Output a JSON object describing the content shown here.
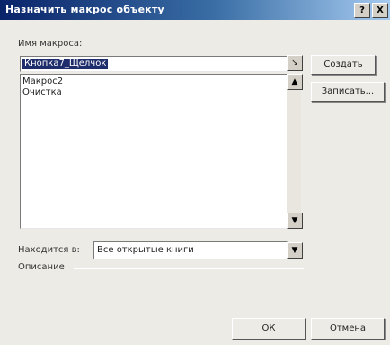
{
  "dialog": {
    "title": "Назначить макрос объекту",
    "help_label": "?",
    "close_label": "X"
  },
  "macro_name": {
    "label": "Имя макроса:",
    "value": "Кнопка7_Щелчок"
  },
  "macro_list": {
    "items": [
      "Макрос2",
      "Очистка"
    ]
  },
  "buttons": {
    "create": "Создать",
    "record": "Записать...",
    "ok": "ОК",
    "cancel": "Отмена"
  },
  "location": {
    "label": "Находится в:",
    "value": "Все открытые книги"
  },
  "description": {
    "label": "Описание"
  }
}
